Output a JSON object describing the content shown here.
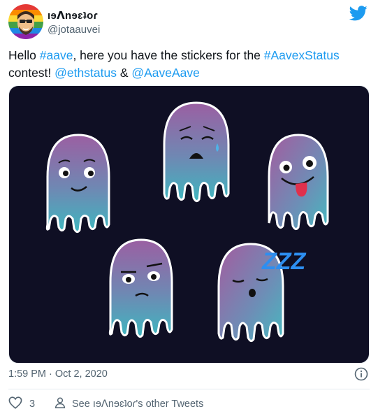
{
  "user": {
    "display_name": "ıɘⴷnɘɛʇoɾ",
    "handle": "@jotaauvei"
  },
  "tweet": {
    "parts": [
      {
        "t": "Hello "
      },
      {
        "t": "#aave",
        "link": true
      },
      {
        "t": ", here you have the stickers for the "
      },
      {
        "t": "#AavexStatus",
        "link": true
      },
      {
        "t": " contest! "
      },
      {
        "t": "@ethstatus",
        "link": true
      },
      {
        "t": " & "
      },
      {
        "t": "@AaveAave",
        "link": true
      }
    ]
  },
  "media": {
    "sleep_text": "ZZZ",
    "colors": {
      "background": "#0f0f24",
      "ghost_top": "#9b5fa2",
      "ghost_bottom": "#3fb6bf",
      "sleep": "#2d8ef0"
    }
  },
  "meta": {
    "timestamp": "1:59 PM · Oct 2, 2020"
  },
  "actions": {
    "likes": "3",
    "see_other": "See ıɘⴷnɘɛʇoɾ's other Tweets"
  },
  "icons": {
    "brand": "twitter-bird-icon",
    "like": "heart-icon",
    "profile": "person-icon",
    "info": "info-icon"
  },
  "colors": {
    "link": "#1d9bf0",
    "secondary": "#536471",
    "brand": "#1d9bf0"
  }
}
